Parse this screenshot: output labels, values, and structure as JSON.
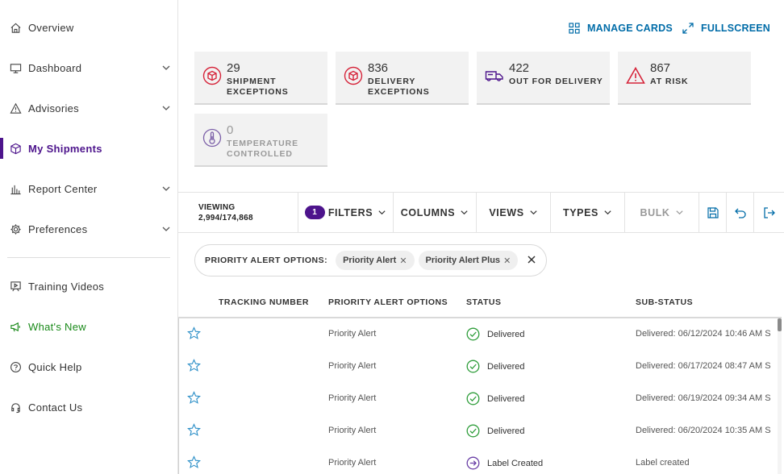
{
  "sidebar": {
    "items": [
      {
        "label": "Overview",
        "icon": "home-icon"
      },
      {
        "label": "Dashboard",
        "icon": "monitor-icon",
        "expandable": true
      },
      {
        "label": "Advisories",
        "icon": "warning-icon",
        "expandable": true
      },
      {
        "label": "My Shipments",
        "icon": "box-icon",
        "active": true
      },
      {
        "label": "Report Center",
        "icon": "bar-chart-icon",
        "expandable": true
      },
      {
        "label": "Preferences",
        "icon": "gear-icon",
        "expandable": true
      },
      {
        "label": "Training Videos",
        "icon": "video-icon"
      },
      {
        "label": "What's New",
        "icon": "megaphone-icon"
      },
      {
        "label": "Quick Help",
        "icon": "help-icon"
      },
      {
        "label": "Contact Us",
        "icon": "headset-icon"
      }
    ]
  },
  "header": {
    "manage_cards": "MANAGE CARDS",
    "fullscreen": "FULLSCREEN"
  },
  "cards": [
    {
      "count": "29",
      "label": "SHIPMENT\nEXCEPTIONS",
      "icon": "exception-box-icon"
    },
    {
      "count": "836",
      "label": "DELIVERY\nEXCEPTIONS",
      "icon": "exception-box-icon"
    },
    {
      "count": "422",
      "label": "OUT FOR DELIVERY",
      "icon": "truck-icon"
    },
    {
      "count": "867",
      "label": "AT RISK",
      "icon": "alert-triangle-icon"
    },
    {
      "count": "0",
      "label": "TEMPERATURE\nCONTROLLED",
      "icon": "thermometer-icon"
    }
  ],
  "toolbar": {
    "viewing_label": "VIEWING",
    "viewing_count": "2,994/174,868",
    "filter_count": "1",
    "filters": "FILTERS",
    "columns": "COLUMNS",
    "views": "VIEWS",
    "types": "TYPES",
    "bulk": "BULK"
  },
  "filter_bar": {
    "label": "PRIORITY ALERT OPTIONS:",
    "chips": [
      "Priority Alert",
      "Priority Alert Plus"
    ]
  },
  "table": {
    "columns": [
      "TRACKING NUMBER",
      "PRIORITY ALERT OPTIONS",
      "STATUS",
      "SUB-STATUS"
    ],
    "rows": [
      {
        "tracking": "",
        "option": "Priority Alert",
        "status": "Delivered",
        "status_type": "delivered",
        "sub_status": "Delivered: 06/12/2024 10:46 AM S"
      },
      {
        "tracking": "",
        "option": "Priority Alert",
        "status": "Delivered",
        "status_type": "delivered",
        "sub_status": "Delivered: 06/17/2024 08:47 AM S"
      },
      {
        "tracking": "",
        "option": "Priority Alert",
        "status": "Delivered",
        "status_type": "delivered",
        "sub_status": "Delivered: 06/19/2024 09:34 AM S"
      },
      {
        "tracking": "",
        "option": "Priority Alert",
        "status": "Delivered",
        "status_type": "delivered",
        "sub_status": "Delivered: 06/20/2024 10:35 AM S"
      },
      {
        "tracking": "",
        "option": "Priority Alert",
        "status": "Label Created",
        "status_type": "label",
        "sub_status": "Label created"
      }
    ]
  },
  "colors": {
    "brand_purple": "#4d148c",
    "link_blue": "#006ca8",
    "delivered_green": "#2e9d3a",
    "exception_red": "#d6243a",
    "star_blue": "#2a8ec7"
  }
}
